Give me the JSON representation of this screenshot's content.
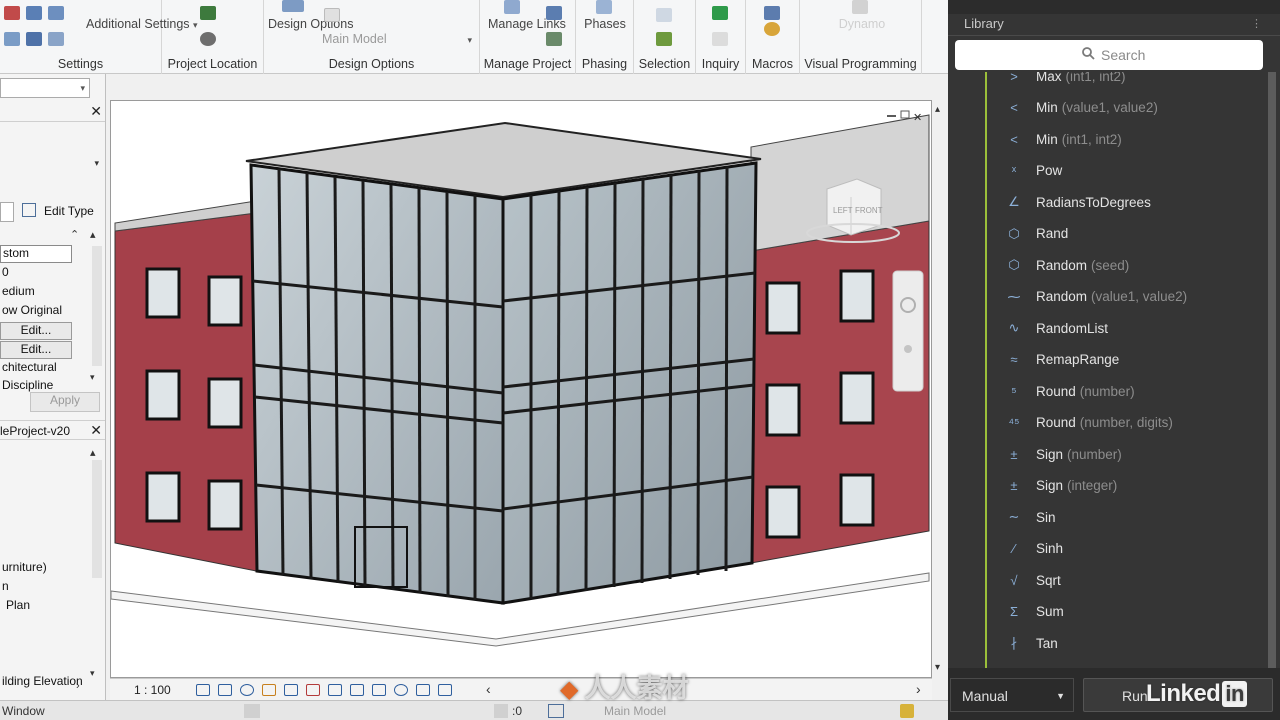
{
  "ribbon": {
    "groups": [
      {
        "label": "Settings",
        "buttons": [
          "Additional Settings"
        ]
      },
      {
        "label": "Project Location",
        "buttons": []
      },
      {
        "label": "Design Options",
        "buttons": [
          "Design Options",
          "Main Model"
        ]
      },
      {
        "label": "Manage Project",
        "buttons": [
          "Manage Links"
        ]
      },
      {
        "label": "Phasing",
        "buttons": [
          "Phases"
        ]
      },
      {
        "label": "Selection",
        "buttons": []
      },
      {
        "label": "Inquiry",
        "buttons": []
      },
      {
        "label": "Macros",
        "buttons": []
      },
      {
        "label": "Visual Programming",
        "buttons": [
          "Dynamo"
        ]
      }
    ]
  },
  "properties": {
    "edit_type": "Edit Type",
    "rows": [
      "stom",
      "0",
      "edium",
      "ow Original",
      "Edit...",
      "Edit...",
      "chitectural",
      "Discipline"
    ],
    "apply": "Apply"
  },
  "browser": {
    "title": "leProject-v20",
    "items": [
      "urniture)",
      "n",
      "Plan",
      "ilding Elevation"
    ]
  },
  "viewport": {
    "scale": "1 : 100",
    "viewcube_left": "LEFT",
    "viewcube_front": "FRONT"
  },
  "status": {
    "window": "Window",
    "count": ":0",
    "model": "Main Model"
  },
  "library": {
    "title": "Library",
    "search_placeholder": "Search",
    "nodes": [
      {
        "name": "Max",
        "args": "(int1, int2)",
        "icon": "greater-than-icon"
      },
      {
        "name": "Min",
        "args": "(value1, value2)",
        "icon": "less-than-icon"
      },
      {
        "name": "Min",
        "args": "(int1, int2)",
        "icon": "less-than-icon"
      },
      {
        "name": "Pow",
        "args": "",
        "icon": "power-icon"
      },
      {
        "name": "RadiansToDegrees",
        "args": "",
        "icon": "angle-icon"
      },
      {
        "name": "Rand",
        "args": "",
        "icon": "dice-icon"
      },
      {
        "name": "Random",
        "args": "(seed)",
        "icon": "dice-icon"
      },
      {
        "name": "Random",
        "args": "(value1, value2)",
        "icon": "range-icon"
      },
      {
        "name": "RandomList",
        "args": "",
        "icon": "random-list-icon"
      },
      {
        "name": "RemapRange",
        "args": "",
        "icon": "remap-icon"
      },
      {
        "name": "Round",
        "args": "(number)",
        "icon": "round-icon"
      },
      {
        "name": "Round",
        "args": "(number, digits)",
        "icon": "round-digits-icon"
      },
      {
        "name": "Sign",
        "args": "(number)",
        "icon": "sign-icon"
      },
      {
        "name": "Sign",
        "args": "(integer)",
        "icon": "sign-icon"
      },
      {
        "name": "Sin",
        "args": "",
        "icon": "sine-wave-icon"
      },
      {
        "name": "Sinh",
        "args": "",
        "icon": "sinh-curve-icon"
      },
      {
        "name": "Sqrt",
        "args": "",
        "icon": "sqrt-icon"
      },
      {
        "name": "Sum",
        "args": "",
        "icon": "sigma-icon"
      },
      {
        "name": "Tan",
        "args": "",
        "icon": "tangent-icon"
      }
    ],
    "run_mode": "Manual",
    "run_label": "Run",
    "accent": "#9bbf3a"
  },
  "overlay": {
    "brand": "Linked",
    "brand_in": "in",
    "watermark": "人人素材"
  }
}
